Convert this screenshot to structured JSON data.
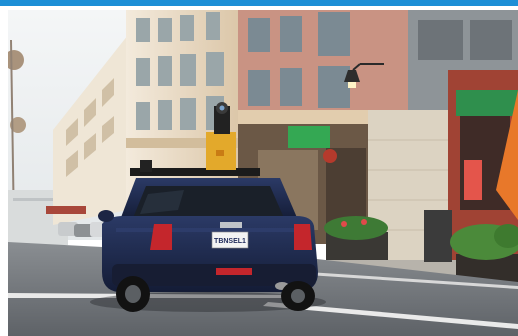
{
  "photo": {
    "subject": "street-view-camera-car",
    "license_plate": "TBNSEL1"
  },
  "colors": {
    "frame_accent": "#1d8fd6",
    "car_body": "#1e2a4e",
    "building": "#e9dcc8",
    "sky": "#eef1f3",
    "road": "#6f747a",
    "awning_green": "#34a853",
    "umbrella_orange": "#e8782a"
  }
}
